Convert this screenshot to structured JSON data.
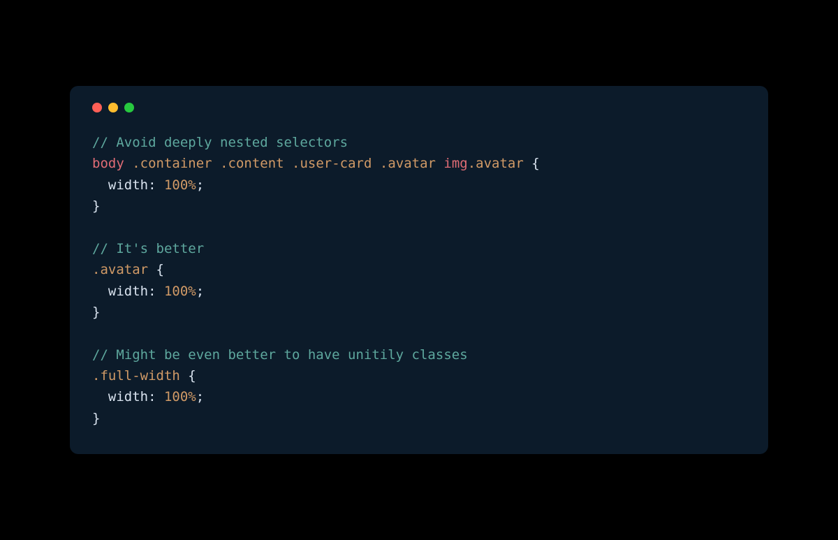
{
  "code": {
    "lines": [
      {
        "type": "comment",
        "tokens": [
          {
            "cls": "comment",
            "text": "// Avoid deeply nested selectors"
          }
        ]
      },
      {
        "type": "selector",
        "tokens": [
          {
            "cls": "tag",
            "text": "body"
          },
          {
            "cls": "punct",
            "text": " "
          },
          {
            "cls": "class",
            "text": ".container"
          },
          {
            "cls": "punct",
            "text": " "
          },
          {
            "cls": "class",
            "text": ".content"
          },
          {
            "cls": "punct",
            "text": " "
          },
          {
            "cls": "class",
            "text": ".user-card"
          },
          {
            "cls": "punct",
            "text": " "
          },
          {
            "cls": "class",
            "text": ".avatar"
          },
          {
            "cls": "punct",
            "text": " "
          },
          {
            "cls": "tag",
            "text": "img"
          },
          {
            "cls": "class",
            "text": ".avatar"
          },
          {
            "cls": "punct",
            "text": " "
          },
          {
            "cls": "brace",
            "text": "{"
          }
        ]
      },
      {
        "type": "rule",
        "tokens": [
          {
            "cls": "punct",
            "text": "  "
          },
          {
            "cls": "property",
            "text": "width"
          },
          {
            "cls": "punct",
            "text": ": "
          },
          {
            "cls": "value",
            "text": "100%"
          },
          {
            "cls": "punct",
            "text": ";"
          }
        ]
      },
      {
        "type": "close",
        "tokens": [
          {
            "cls": "brace",
            "text": "}"
          }
        ]
      },
      {
        "type": "blank",
        "tokens": [
          {
            "cls": "punct",
            "text": ""
          }
        ]
      },
      {
        "type": "comment",
        "tokens": [
          {
            "cls": "comment",
            "text": "// It's better"
          }
        ]
      },
      {
        "type": "selector",
        "tokens": [
          {
            "cls": "class",
            "text": ".avatar"
          },
          {
            "cls": "punct",
            "text": " "
          },
          {
            "cls": "brace",
            "text": "{"
          }
        ]
      },
      {
        "type": "rule",
        "tokens": [
          {
            "cls": "punct",
            "text": "  "
          },
          {
            "cls": "property",
            "text": "width"
          },
          {
            "cls": "punct",
            "text": ": "
          },
          {
            "cls": "value",
            "text": "100%"
          },
          {
            "cls": "punct",
            "text": ";"
          }
        ]
      },
      {
        "type": "close",
        "tokens": [
          {
            "cls": "brace",
            "text": "}"
          }
        ]
      },
      {
        "type": "blank",
        "tokens": [
          {
            "cls": "punct",
            "text": ""
          }
        ]
      },
      {
        "type": "comment",
        "tokens": [
          {
            "cls": "comment",
            "text": "// Might be even better to have unitily classes"
          }
        ]
      },
      {
        "type": "selector",
        "tokens": [
          {
            "cls": "class",
            "text": ".full-width"
          },
          {
            "cls": "punct",
            "text": " "
          },
          {
            "cls": "brace",
            "text": "{"
          }
        ]
      },
      {
        "type": "rule",
        "tokens": [
          {
            "cls": "punct",
            "text": "  "
          },
          {
            "cls": "property",
            "text": "width"
          },
          {
            "cls": "punct",
            "text": ": "
          },
          {
            "cls": "value",
            "text": "100%"
          },
          {
            "cls": "punct",
            "text": ";"
          }
        ]
      },
      {
        "type": "close",
        "tokens": [
          {
            "cls": "brace",
            "text": "}"
          }
        ]
      }
    ]
  }
}
